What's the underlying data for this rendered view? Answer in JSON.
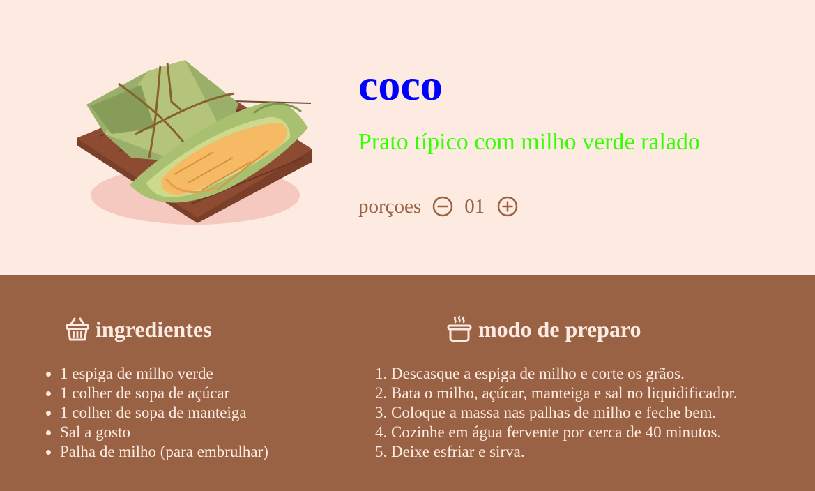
{
  "recipe": {
    "title": "coco",
    "subtitle": "Prato típico com milho verde ralado",
    "image_name": "pamonha-illustration",
    "portions": {
      "label": "porçoes",
      "count": "01",
      "decrement_icon": "minus-circle-icon",
      "increment_icon": "plus-circle-icon"
    }
  },
  "ingredients": {
    "title": "ingredientes",
    "icon": "basket-icon",
    "items": [
      "1 espiga de milho verde",
      "1 colher de sopa de açúcar",
      "1 colher de sopa de manteiga",
      "Sal a gosto",
      "Palha de milho (para embrulhar)"
    ]
  },
  "preparation": {
    "title": "modo de preparo",
    "icon": "cooking-pot-icon",
    "steps": [
      "Descasque a espiga de milho e corte os grãos.",
      "Bata o milho, açúcar, manteiga e sal no liquidificador.",
      "Coloque a massa nas palhas de milho e feche bem.",
      "Cozinhe em água fervente por cerca de 40 minutos.",
      "Deixe esfriar e sirva."
    ]
  },
  "colors": {
    "page_background": "#fdebe1",
    "bottom_background": "#9a6244",
    "title": "#0000ff",
    "subtitle": "#33ff00",
    "accent_brown": "#9a6244",
    "light_text": "#fdebe1"
  }
}
